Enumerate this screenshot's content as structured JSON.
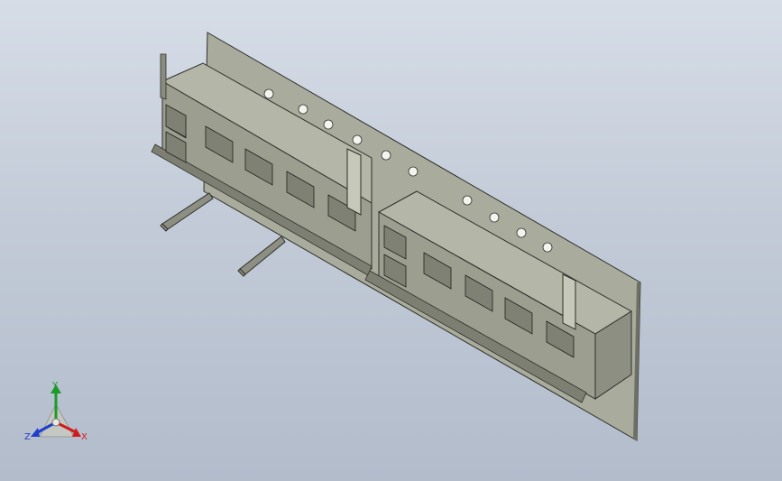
{
  "colors": {
    "background_top": "#d6dde7",
    "background_bottom": "#b2bccb",
    "plate_fill": "#a9ab9c",
    "plate_edge": "#6e7064",
    "part_fill": "#b4b6a7",
    "part_dark": "#7d7f72",
    "outline": "#2e2f2a",
    "axis_x": "#d21b1b",
    "axis_y": "#1c9a2a",
    "axis_z": "#1d3fcc"
  },
  "triad": {
    "x_label": "X",
    "y_label": "Y",
    "z_label": "Z"
  },
  "icons": [
    "coordinate-triad-icon"
  ]
}
